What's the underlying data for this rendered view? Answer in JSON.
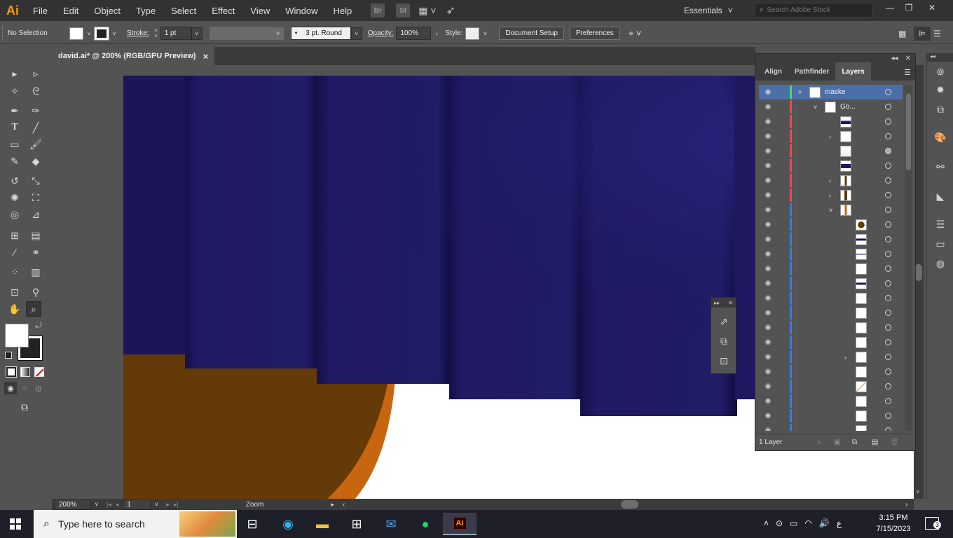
{
  "app": {
    "logo": "Ai",
    "accent": "#ff9a00"
  },
  "menus": [
    "File",
    "Edit",
    "Object",
    "Type",
    "Select",
    "Effect",
    "View",
    "Window",
    "Help"
  ],
  "menubar_icons": [
    "Br",
    "St"
  ],
  "workspace": "Essentials",
  "stock_search": {
    "placeholder": "Search Adobe Stock"
  },
  "control": {
    "selection": "No Selection",
    "stroke_label": "Stroke:",
    "stroke_value": "1 pt",
    "brush": "3 pt. Round",
    "opacity_label": "Opacity:",
    "opacity_value": "100%",
    "style_label": "Style:",
    "document_setup": "Document Setup",
    "preferences": "Preferences"
  },
  "document_tab": {
    "title": "david.ai* @ 200% (RGB/GPU Preview)",
    "close": "×"
  },
  "status_bar": {
    "zoom": "200%",
    "artboard": "1",
    "tool": "Zoom"
  },
  "panel": {
    "tabs": [
      "Align",
      "Pathfinder",
      "Layers"
    ],
    "active_tab": "Layers",
    "footer": "1 Layer",
    "layers": [
      {
        "name": "maske",
        "level": 0,
        "expanded": true,
        "color": "#4cd964",
        "selected": true
      },
      {
        "name": "Go...",
        "level": 1,
        "expanded": true,
        "color": "#e84a4a"
      },
      {
        "name": "",
        "level": 2,
        "color": "#e84a4a"
      },
      {
        "name": "",
        "level": 2,
        "collapsed": true,
        "color": "#e84a4a"
      },
      {
        "name": "",
        "level": 2,
        "color": "#e84a4a"
      },
      {
        "name": "",
        "level": 2,
        "color": "#e84a4a"
      },
      {
        "name": "",
        "level": 2,
        "collapsed": true,
        "color": "#e84a4a"
      },
      {
        "name": "",
        "level": 2,
        "collapsed": true,
        "color": "#e84a4a"
      },
      {
        "name": "",
        "level": 2,
        "expanded": true,
        "color": "#3b7be0"
      },
      {
        "name": "",
        "level": 3,
        "color": "#3b7be0"
      },
      {
        "name": "",
        "level": 3,
        "color": "#3b7be0"
      },
      {
        "name": "",
        "level": 3,
        "color": "#3b7be0"
      },
      {
        "name": "",
        "level": 3,
        "color": "#3b7be0"
      },
      {
        "name": "",
        "level": 3,
        "color": "#3b7be0"
      },
      {
        "name": "",
        "level": 3,
        "color": "#3b7be0"
      },
      {
        "name": "",
        "level": 3,
        "color": "#3b7be0"
      },
      {
        "name": "",
        "level": 3,
        "color": "#3b7be0"
      },
      {
        "name": "",
        "level": 3,
        "color": "#3b7be0"
      },
      {
        "name": "",
        "level": 3,
        "collapsed": true,
        "color": "#3b7be0"
      },
      {
        "name": "",
        "level": 3,
        "color": "#3b7be0"
      },
      {
        "name": "",
        "level": 3,
        "color": "#3b7be0"
      },
      {
        "name": "",
        "level": 3,
        "color": "#3b7be0"
      },
      {
        "name": "",
        "level": 3,
        "color": "#3b7be0"
      },
      {
        "name": "",
        "level": 3,
        "color": "#3b7be0"
      }
    ]
  },
  "colors": {
    "navy": "#1d1860",
    "brown": "#633a08",
    "orange": "#c8650f"
  },
  "taskbar": {
    "search_placeholder": "Type here to search",
    "time": "3:15 PM",
    "date": "7/15/2023",
    "lang": "ع",
    "notifications": "3"
  }
}
